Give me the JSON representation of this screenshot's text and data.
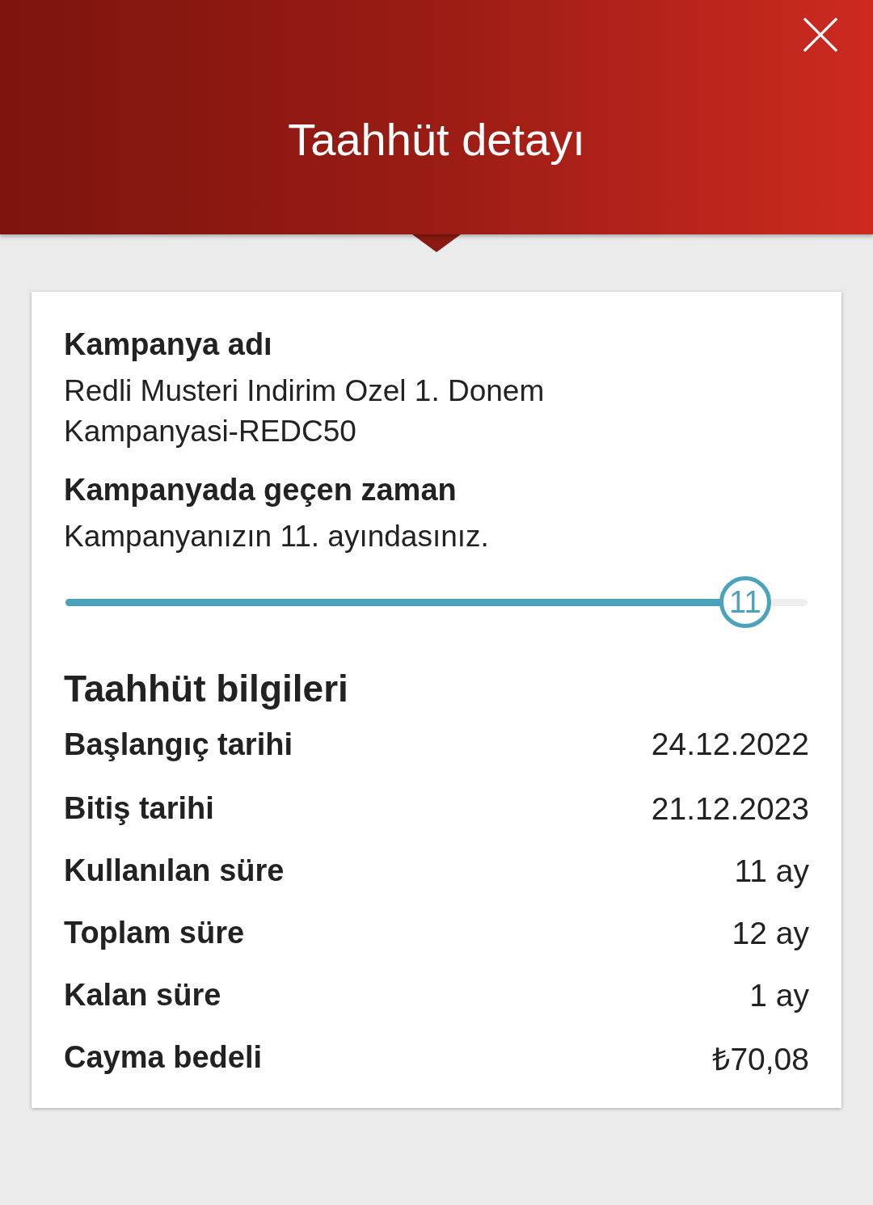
{
  "header": {
    "title": "Taahhüt detayı"
  },
  "campaign": {
    "name_label": "Kampanya adı",
    "name": "Redli Musteri Indirim Ozel 1. Donem Kampanyasi-REDC50",
    "elapsed_label": "Kampanyada geçen zaman",
    "elapsed_text": "Kampanyanızın 11. ayındasınız.",
    "progress": {
      "level": 0.917,
      "thumb_label": "11"
    }
  },
  "commitment": {
    "title": "Taahhüt bilgileri",
    "rows": [
      {
        "label": "Başlangıç tarihi",
        "value": "24.12.2022"
      },
      {
        "label": "Bitiş tarihi",
        "value": "21.12.2023"
      },
      {
        "label": "Kullanılan süre",
        "value": "11 ay"
      },
      {
        "label": "Toplam süre",
        "value": "12 ay"
      },
      {
        "label": "Kalan süre",
        "value": "1 ay"
      },
      {
        "label": "Cayma bedeli",
        "value": "₺70,08"
      }
    ]
  }
}
